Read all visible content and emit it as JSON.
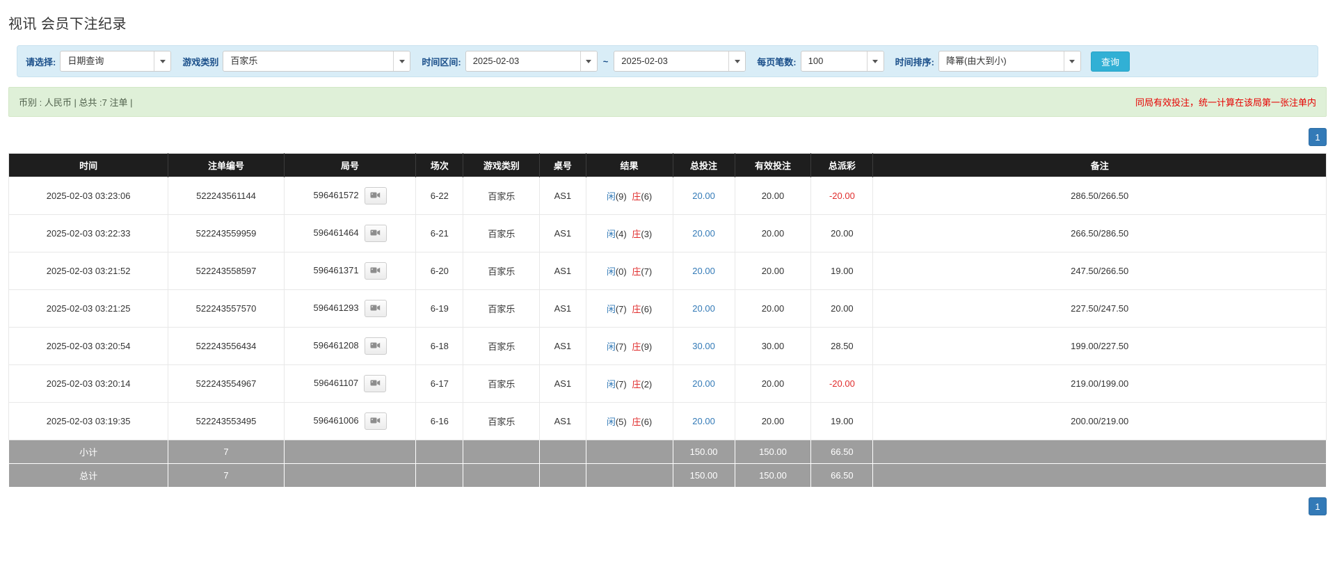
{
  "page": {
    "title": "视讯 会员下注纪录"
  },
  "filter_bar": {
    "select": {
      "label": "请选择:",
      "value": "日期查询"
    },
    "game_type": {
      "label": "游戏类别",
      "value": "百家乐"
    },
    "date_range": {
      "label": "时间区间:",
      "from": "2025-02-03",
      "separator": "~",
      "to": "2025-02-03"
    },
    "page_size": {
      "label": "每页笔数:",
      "value": "100"
    },
    "sort": {
      "label": "时间排序:",
      "value": "降幂(由大到小)"
    },
    "search_button": "查询"
  },
  "summary_bar": {
    "left_text": "币别 : 人民币 | 总共 :7 注单 |",
    "right_text": "同局有效投注，统一计算在该局第一张注单内"
  },
  "pagination": {
    "current_page": "1"
  },
  "table": {
    "headers": [
      "时间",
      "注单编号",
      "局号",
      "场次",
      "游戏类别",
      "桌号",
      "结果",
      "总投注",
      "有效投注",
      "总派彩",
      "备注"
    ],
    "rows": [
      {
        "time": "2025-02-03 03:23:06",
        "bet_id": "522243561144",
        "round_id": "596461572",
        "session": "6-22",
        "game_type": "百家乐",
        "table_no": "AS1",
        "player": "闲",
        "player_score": "(9)",
        "banker": "庄",
        "banker_score": "(6)",
        "total_bet": "20.00",
        "valid_bet": "20.00",
        "payout": "-20.00",
        "remark": "286.50/266.50"
      },
      {
        "time": "2025-02-03 03:22:33",
        "bet_id": "522243559959",
        "round_id": "596461464",
        "session": "6-21",
        "game_type": "百家乐",
        "table_no": "AS1",
        "player": "闲",
        "player_score": "(4)",
        "banker": "庄",
        "banker_score": "(3)",
        "total_bet": "20.00",
        "valid_bet": "20.00",
        "payout": "20.00",
        "remark": "266.50/286.50"
      },
      {
        "time": "2025-02-03 03:21:52",
        "bet_id": "522243558597",
        "round_id": "596461371",
        "session": "6-20",
        "game_type": "百家乐",
        "table_no": "AS1",
        "player": "闲",
        "player_score": "(0)",
        "banker": "庄",
        "banker_score": "(7)",
        "total_bet": "20.00",
        "valid_bet": "20.00",
        "payout": "19.00",
        "remark": "247.50/266.50"
      },
      {
        "time": "2025-02-03 03:21:25",
        "bet_id": "522243557570",
        "round_id": "596461293",
        "session": "6-19",
        "game_type": "百家乐",
        "table_no": "AS1",
        "player": "闲",
        "player_score": "(7)",
        "banker": "庄",
        "banker_score": "(6)",
        "total_bet": "20.00",
        "valid_bet": "20.00",
        "payout": "20.00",
        "remark": "227.50/247.50"
      },
      {
        "time": "2025-02-03 03:20:54",
        "bet_id": "522243556434",
        "round_id": "596461208",
        "session": "6-18",
        "game_type": "百家乐",
        "table_no": "AS1",
        "player": "闲",
        "player_score": "(7)",
        "banker": "庄",
        "banker_score": "(9)",
        "total_bet": "30.00",
        "valid_bet": "30.00",
        "payout": "28.50",
        "remark": "199.00/227.50"
      },
      {
        "time": "2025-02-03 03:20:14",
        "bet_id": "522243554967",
        "round_id": "596461107",
        "session": "6-17",
        "game_type": "百家乐",
        "table_no": "AS1",
        "player": "闲",
        "player_score": "(7)",
        "banker": "庄",
        "banker_score": "(2)",
        "total_bet": "20.00",
        "valid_bet": "20.00",
        "payout": "-20.00",
        "remark": "219.00/199.00"
      },
      {
        "time": "2025-02-03 03:19:35",
        "bet_id": "522243553495",
        "round_id": "596461006",
        "session": "6-16",
        "game_type": "百家乐",
        "table_no": "AS1",
        "player": "闲",
        "player_score": "(5)",
        "banker": "庄",
        "banker_score": "(6)",
        "total_bet": "20.00",
        "valid_bet": "20.00",
        "payout": "19.00",
        "remark": "200.00/219.00"
      }
    ],
    "subtotal_row": {
      "label": "小计",
      "count": "7",
      "total_bet": "150.00",
      "valid_bet": "150.00",
      "payout": "66.50"
    },
    "total_row": {
      "label": "总计",
      "count": "7",
      "total_bet": "150.00",
      "valid_bet": "150.00",
      "payout": "66.50"
    }
  },
  "colors": {
    "accent_blue": "#337ab7",
    "red": "#e02c2c",
    "notice_red": "#e60000",
    "header_bg": "#1e1e1e",
    "footer_bg": "#9e9e9e",
    "filter_bg": "#d9edf7",
    "summary_bg": "#dff0d8",
    "button_blue": "#31b0d5",
    "label_blue": "#1a4f8a"
  }
}
